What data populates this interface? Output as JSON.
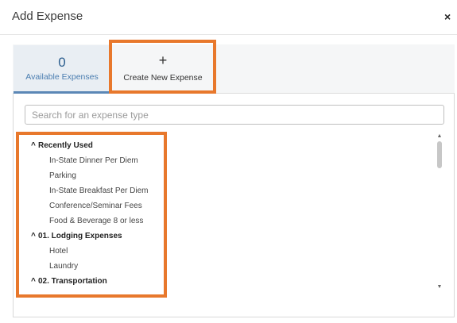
{
  "dialog": {
    "title": "Add Expense",
    "close_symbol": "×"
  },
  "tabs": {
    "available": {
      "count": "0",
      "label": "Available Expenses"
    },
    "create": {
      "icon": "plus-icon",
      "label": "Create New Expense"
    }
  },
  "search": {
    "placeholder": "Search for an expense type",
    "value": ""
  },
  "expense_groups": [
    {
      "label": "Recently Used",
      "items": [
        "In-State Dinner Per Diem",
        "Parking",
        "In-State Breakfast Per Diem",
        "Conference/Seminar Fees",
        "Food & Beverage 8 or less"
      ]
    },
    {
      "label": "01. Lodging Expenses",
      "items": [
        "Hotel",
        "Laundry"
      ]
    },
    {
      "label": "02. Transportation",
      "items": []
    }
  ],
  "caret_symbol": "^",
  "colors": {
    "highlight": "#e8782c",
    "tab_accent": "#5b87b6"
  }
}
